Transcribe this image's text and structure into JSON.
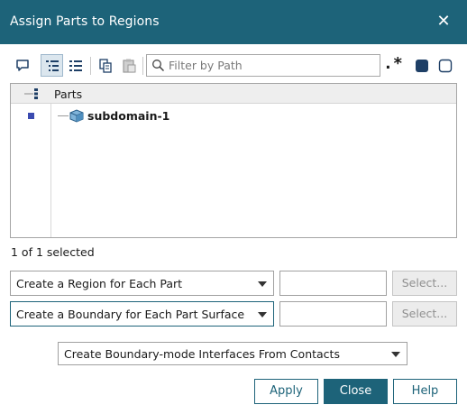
{
  "window": {
    "title": "Assign Parts to Regions",
    "close_symbol": "✕"
  },
  "toolbar": {
    "filter_placeholder": "Filter by Path",
    "regex_symbol": ".*",
    "icons": [
      "comment-icon",
      "tree-view-icon",
      "list-view-icon",
      "copy-icon",
      "paste-icon",
      "search-icon",
      "regex-icon",
      "select-all-icon",
      "deselect-all-icon"
    ]
  },
  "tree": {
    "column_header": "Parts",
    "rows": [
      {
        "label": "subdomain-1",
        "selected": true
      }
    ]
  },
  "status": {
    "selection_text": "1 of 1 selected"
  },
  "region_mode": {
    "selected": "Create a Region for Each Part",
    "select_button": "Select..."
  },
  "boundary_mode": {
    "selected": "Create a Boundary for Each Part Surface",
    "select_button": "Select..."
  },
  "interface_mode": {
    "selected": "Create Boundary-mode Interfaces From Contacts"
  },
  "buttons": {
    "apply": "Apply",
    "close": "Close",
    "help": "Help"
  },
  "colors": {
    "accent": "#1d6379",
    "selection_marker": "#3b4bb0"
  }
}
